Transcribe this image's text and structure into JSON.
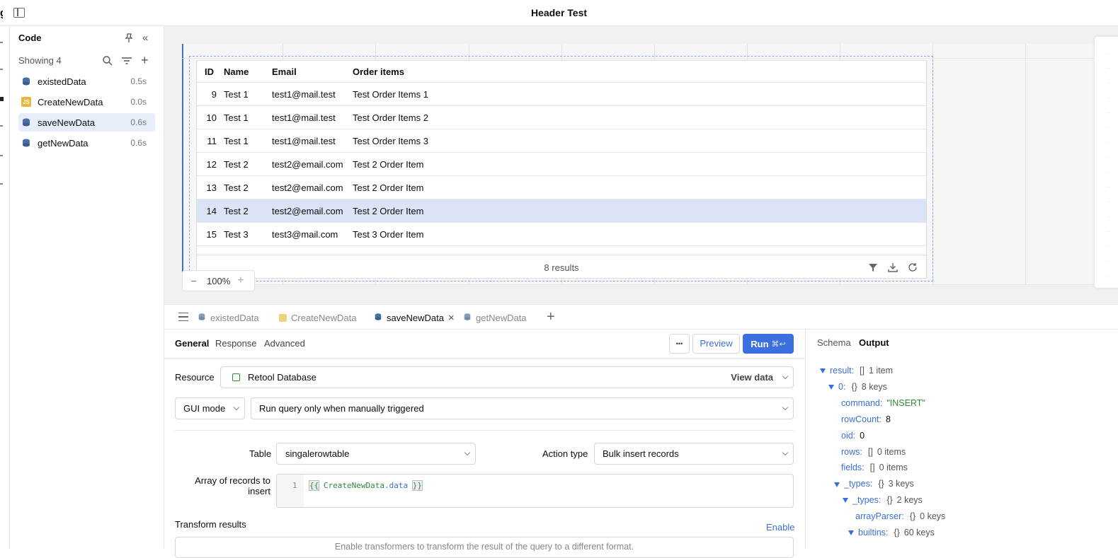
{
  "app": {
    "title": "Header Test"
  },
  "code_panel": {
    "title": "Code",
    "showing": "Showing 4",
    "queries": [
      {
        "name": "existedData",
        "time": "0.5s",
        "type": "db"
      },
      {
        "name": "CreateNewData",
        "time": "0.0s",
        "type": "js"
      },
      {
        "name": "saveNewData",
        "time": "0.6s",
        "type": "db"
      },
      {
        "name": "getNewData",
        "time": "0.6s",
        "type": "db"
      }
    ],
    "js_badge": "JS"
  },
  "table": {
    "headers": {
      "id": "ID",
      "name": "Name",
      "email": "Email",
      "order": "Order items"
    },
    "rows": [
      {
        "id": "9",
        "name": "Test 1",
        "email": "test1@mail.test",
        "order": "Test Order Items 1"
      },
      {
        "id": "10",
        "name": "Test 1",
        "email": "test1@mail.test",
        "order": "Test Order Items 2"
      },
      {
        "id": "11",
        "name": "Test 1",
        "email": "test1@mail.test",
        "order": "Test Order Items 3"
      },
      {
        "id": "12",
        "name": "Test 2",
        "email": "test2@email.com",
        "order": "Test 2 Order Item"
      },
      {
        "id": "13",
        "name": "Test 2",
        "email": "test2@email.com",
        "order": "Test 2 Order Item"
      },
      {
        "id": "14",
        "name": "Test 2",
        "email": "test2@email.com",
        "order": "Test 2 Order Item"
      },
      {
        "id": "15",
        "name": "Test 3",
        "email": "test3@mail.com",
        "order": "Test 3 Order Item"
      }
    ],
    "footer": "8 results"
  },
  "zoom": {
    "level": "100%",
    "minus": "−",
    "plus": "+"
  },
  "query_tabs": [
    {
      "label": "existedData"
    },
    {
      "label": "CreateNewData"
    },
    {
      "label": "saveNewData"
    },
    {
      "label": "getNewData"
    }
  ],
  "editor": {
    "subtabs": {
      "general": "General",
      "response": "Response",
      "advanced": "Advanced"
    },
    "more": "•••",
    "preview": "Preview",
    "run": "Run",
    "run_shortcut": "⌘↩",
    "resource_label": "Resource",
    "resource_value": "Retool Database",
    "view_data": "View data",
    "mode": "GUI mode",
    "trigger": "Run query only when manually triggered",
    "table_label": "Table",
    "table_value": "singalerowtable",
    "action_label": "Action type",
    "action_value": "Bulk insert records",
    "records_label_1": "Array of records to",
    "records_label_2": "insert",
    "line_no": "1",
    "code_open": "{{",
    "code_obj": "CreateNewData",
    "code_prop": ".data",
    "code_close": "}}",
    "transform_label": "Transform results",
    "enable": "Enable",
    "transform_hint": "Enable transformers to transform the result of the query to a different format."
  },
  "output": {
    "tabs": {
      "schema": "Schema",
      "output": "Output"
    },
    "lines": [
      {
        "key": "result:",
        "type": "[]",
        "info": "1 item"
      },
      {
        "key": "0:",
        "type": "{}",
        "info": "8 keys"
      },
      {
        "key": "command:",
        "value": "\"INSERT\""
      },
      {
        "key": "rowCount:",
        "value": "8"
      },
      {
        "key": "oid:",
        "value": "0"
      },
      {
        "key": "rows:",
        "type": "[]",
        "info": "0 items"
      },
      {
        "key": "fields:",
        "type": "[]",
        "info": "0 items"
      },
      {
        "key": "_types:",
        "type": "{}",
        "info": "3 keys"
      },
      {
        "key": "_types:",
        "type": "{}",
        "info": "2 keys"
      },
      {
        "key": "arrayParser:",
        "type": "{}",
        "info": "0 keys"
      },
      {
        "key": "builtins:",
        "type": "{}",
        "info": "60 keys"
      }
    ]
  },
  "colors": {
    "accent": "#3c6fe0",
    "selected_row": "#dbe4f7",
    "string": "#2f8a3c"
  }
}
